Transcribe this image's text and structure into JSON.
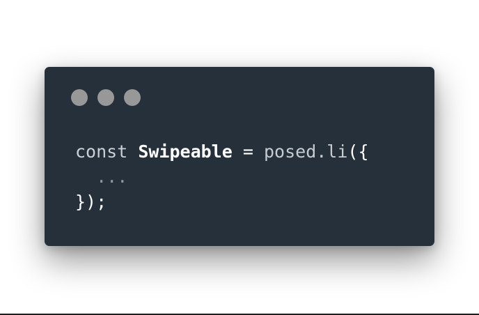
{
  "window": {
    "buttons": [
      {
        "name": "close-dot",
        "color": "#989898"
      },
      {
        "name": "minimize-dot",
        "color": "#989898"
      },
      {
        "name": "maximize-dot",
        "color": "#989898"
      }
    ]
  },
  "code": {
    "line1": {
      "keyword": "const",
      "identifier": "Swipeable",
      "operator": "=",
      "call": "posed.li",
      "open": "({"
    },
    "line2": {
      "ellipsis": "..."
    },
    "line3": {
      "close": "});"
    }
  },
  "colors": {
    "background": "#25303a",
    "text": "#cfd3d8",
    "identifier": "#ffffff",
    "muted": "#8f98a3"
  }
}
